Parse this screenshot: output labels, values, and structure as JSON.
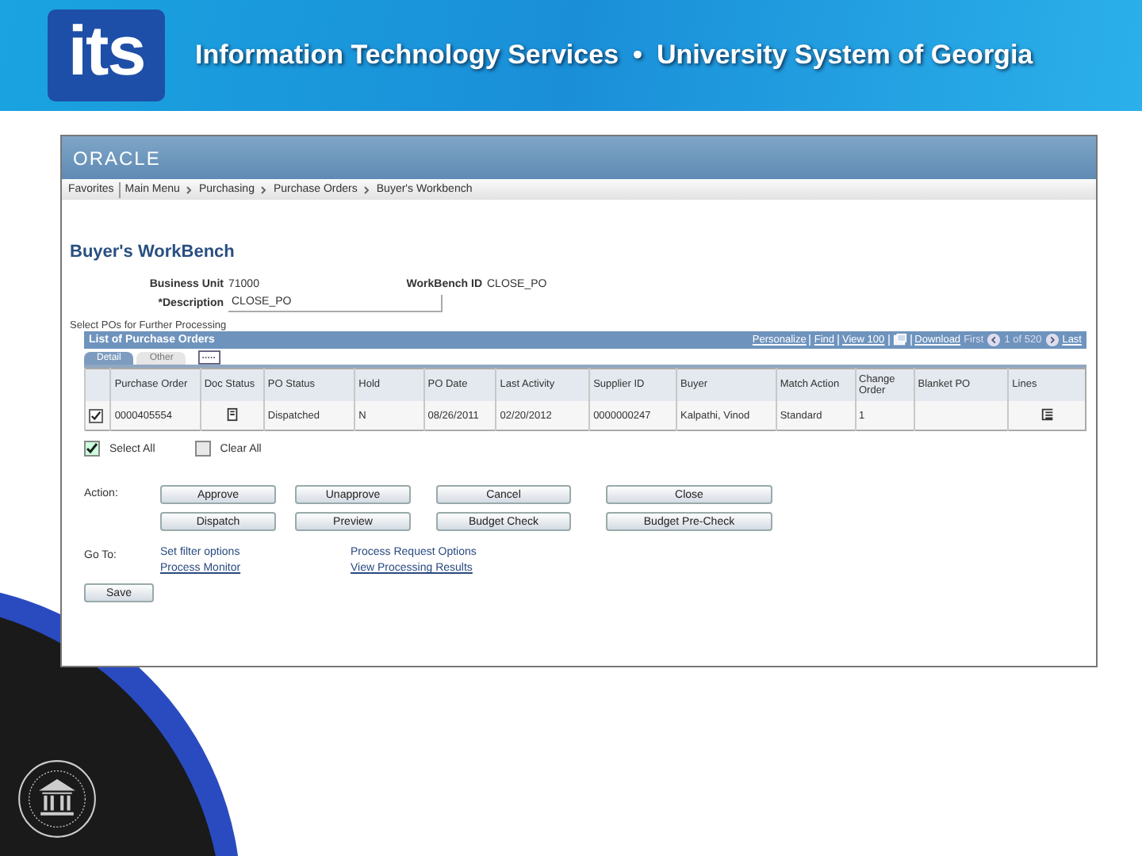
{
  "header": {
    "logo": "its",
    "title_left": "Information Technology Services",
    "separator": "•",
    "title_right": "University System of Georgia"
  },
  "app": {
    "brand": "ORACLE",
    "breadcrumbs": [
      "Favorites",
      "Main Menu",
      "Purchasing",
      "Purchase Orders",
      "Buyer's Workbench"
    ],
    "page_title": "Buyer's WorkBench",
    "business_unit": {
      "label": "Business Unit",
      "value": "71000"
    },
    "workbench_id": {
      "label": "WorkBench ID",
      "value": "CLOSE_PO"
    },
    "description": {
      "label": "*Description",
      "value": "CLOSE_PO"
    },
    "section_label": "Select POs for Further Processing",
    "grid": {
      "title": "List of Purchase Orders",
      "nav": {
        "personalize": "Personalize",
        "find": "Find",
        "view": "View 100",
        "download": "Download",
        "first": "First",
        "count": "1 of 520",
        "last": "Last"
      },
      "tabs": [
        {
          "label": "Detail",
          "selected": true
        },
        {
          "label": "Other",
          "selected": false
        }
      ],
      "columns": [
        "Purchase Order",
        "Doc Status",
        "PO Status",
        "Hold",
        "PO Date",
        "Last Activity",
        "Supplier ID",
        "Buyer",
        "Match Action",
        "Change Order",
        "Blanket PO",
        "Lines"
      ],
      "rows": [
        {
          "checked": true,
          "purchase_order": "0000405554",
          "po_status": "Dispatched",
          "hold": "N",
          "po_date": "08/26/2011",
          "last_activity": "02/20/2012",
          "supplier_id": "0000000247",
          "buyer": "Kalpathi, Vinod",
          "match_action": "Standard",
          "change_order": "1"
        }
      ]
    },
    "select_all": {
      "label": "Select All",
      "checked": true
    },
    "clear_all": {
      "label": "Clear All",
      "checked": false
    },
    "action_label": "Action:",
    "actions": [
      [
        "Approve",
        "Unapprove",
        "Cancel",
        "Close"
      ],
      [
        "Dispatch",
        "Preview",
        "Budget Check",
        "Budget Pre-Check"
      ]
    ],
    "goto_label": "Go To:",
    "goto": [
      [
        {
          "label": "Set filter options",
          "kind": "plain"
        },
        {
          "label": "Process Request Options",
          "kind": "plain"
        }
      ],
      [
        {
          "label": "Process Monitor",
          "kind": "link"
        },
        {
          "label": "View Processing Results",
          "kind": "link"
        }
      ]
    ],
    "save": "Save"
  }
}
